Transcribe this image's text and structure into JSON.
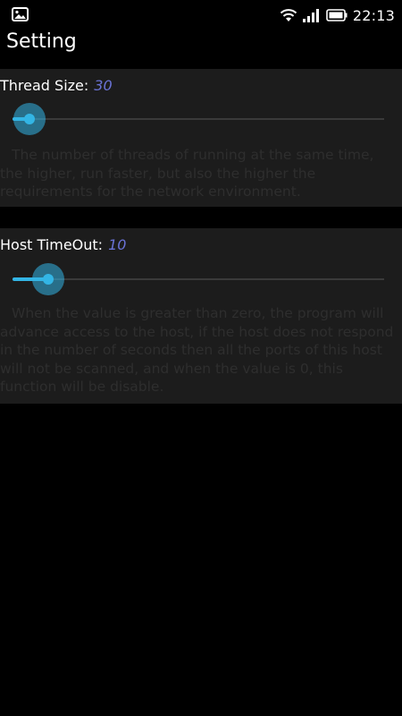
{
  "status_bar": {
    "time": "22:13",
    "left_icon": "gallery-notification-icon",
    "right_icons": [
      "wifi-icon",
      "signal-icon",
      "battery-icon"
    ]
  },
  "title_bar": {
    "title": "Setting"
  },
  "thread_size": {
    "label": "Thread Size:",
    "value": "30",
    "slider_fraction": 0.045,
    "description": "The number of threads of running at the same time, the higher, run faster, but also the higher the requirements for the network environment."
  },
  "host_timeout": {
    "label": "Host TimeOut:",
    "value": "10",
    "slider_fraction": 0.095,
    "description": "When the value is greater than zero, the program will advance access to the host, if the host does not respond in the number of seconds then all the ports of this host will not be scanned, and when the value is 0, this function will be disable."
  },
  "colors": {
    "accent": "#33b5e5",
    "value_text": "#6a73d6",
    "panel_bg": "#1c1c1c",
    "background": "#000000"
  }
}
